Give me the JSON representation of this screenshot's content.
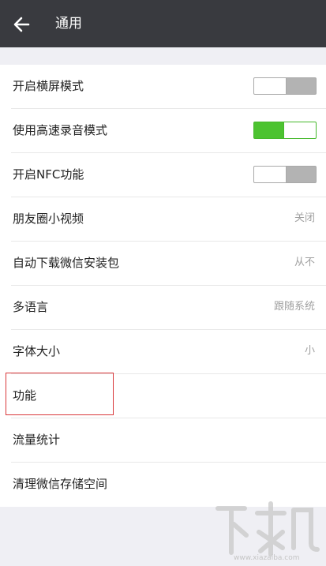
{
  "header": {
    "title": "通用"
  },
  "settings": [
    {
      "label": "开启横屏模式",
      "toggle": "off"
    },
    {
      "label": "使用高速录音模式",
      "toggle": "on"
    },
    {
      "label": "开启NFC功能",
      "toggle": "off"
    },
    {
      "label": "朋友圈小视频",
      "value": "关闭"
    },
    {
      "label": "自动下载微信安装包",
      "value": "从不"
    },
    {
      "label": "多语言",
      "value": "跟随系统"
    },
    {
      "label": "字体大小",
      "value": "小"
    },
    {
      "label": "功能"
    },
    {
      "label": "流量统计"
    },
    {
      "label": "清理微信存储空间"
    }
  ],
  "watermark": {
    "text": "下载吧",
    "url": "www.xiazaiba.com"
  },
  "colors": {
    "header_bg": "#393a3f",
    "toggle_on": "#4cc330",
    "highlight": "#d9383b"
  }
}
